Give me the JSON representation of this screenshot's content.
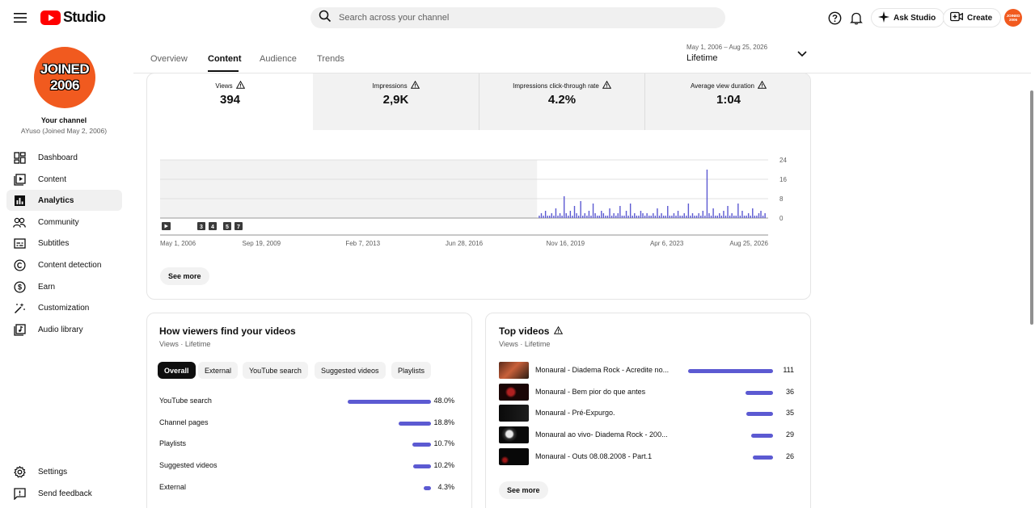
{
  "header": {
    "logo_text": "Studio",
    "search_placeholder": "Search across your channel",
    "ask_studio": "Ask Studio",
    "create": "Create",
    "avatar_text": "JOINED 2006"
  },
  "sidebar": {
    "avatar_line1": "JOINED",
    "avatar_line2": "2006",
    "your_channel": "Your channel",
    "channel_name": "AYuso (Joined May 2, 2006)",
    "items": [
      {
        "label": "Dashboard",
        "icon": "dashboard-icon"
      },
      {
        "label": "Content",
        "icon": "content-icon"
      },
      {
        "label": "Analytics",
        "icon": "analytics-icon"
      },
      {
        "label": "Community",
        "icon": "community-icon"
      },
      {
        "label": "Subtitles",
        "icon": "subtitles-icon"
      },
      {
        "label": "Content detection",
        "icon": "copyright-icon"
      },
      {
        "label": "Earn",
        "icon": "dollar-icon"
      },
      {
        "label": "Customization",
        "icon": "magic-wand-icon"
      },
      {
        "label": "Audio library",
        "icon": "audio-library-icon"
      }
    ],
    "bottom_items": [
      {
        "label": "Settings",
        "icon": "gear-icon"
      },
      {
        "label": "Send feedback",
        "icon": "feedback-icon"
      }
    ]
  },
  "tabs": [
    {
      "label": "Overview"
    },
    {
      "label": "Content"
    },
    {
      "label": "Audience"
    },
    {
      "label": "Trends"
    }
  ],
  "date_selector": {
    "range": "May 1, 2006 – Aug 25, 2026",
    "label": "Lifetime"
  },
  "metrics": [
    {
      "label": "Views",
      "value": "394"
    },
    {
      "label": "Impressions",
      "value": "2,9K"
    },
    {
      "label": "Impressions click-through rate",
      "value": "4.2%"
    },
    {
      "label": "Average view duration",
      "value": "1:04"
    }
  ],
  "chart_data": {
    "type": "bar",
    "series": [
      {
        "values": [
          1,
          2,
          1,
          3,
          1,
          1,
          2,
          1,
          4,
          1,
          2,
          1,
          9,
          2,
          1,
          3,
          1,
          5,
          2,
          1,
          7,
          1,
          2,
          1,
          3,
          1,
          6,
          2,
          1,
          1,
          3,
          2,
          1,
          1,
          4,
          1,
          2,
          1,
          2,
          5,
          1,
          1,
          3,
          1,
          6,
          1,
          2,
          1,
          1,
          3,
          2,
          1,
          2,
          1,
          1,
          2,
          1,
          4,
          1,
          2,
          1,
          1,
          5,
          1,
          1,
          2,
          1,
          3,
          1,
          1,
          2,
          1,
          6,
          1,
          2,
          1,
          1,
          2,
          1,
          3,
          1,
          20,
          2,
          1,
          4,
          1,
          1,
          2,
          1,
          3,
          1,
          5,
          1,
          2,
          1,
          1,
          6,
          1,
          3,
          1,
          1,
          2,
          1,
          4,
          1,
          1,
          2,
          3,
          1,
          2
        ]
      }
    ],
    "x_range": [
      "May 1, 2006",
      "Aug 25, 2026"
    ],
    "x_ticks": [
      "May 1, 2006",
      "Sep 19, 2009",
      "Feb 7, 2013",
      "Jun 28, 2016",
      "Nov 16, 2019",
      "Apr 6, 2023",
      "Aug 25, 2026"
    ],
    "y_ticks": [
      "24",
      "16",
      "8",
      "0"
    ],
    "ylim": [
      0,
      24
    ],
    "grid": true,
    "markers": [
      "3",
      "4",
      "5",
      "7"
    ]
  },
  "chart": {
    "see_more": "See more"
  },
  "traffic": {
    "title": "How viewers find your videos",
    "subtitle": "Views · Lifetime",
    "chips": [
      {
        "label": "Overall"
      },
      {
        "label": "External"
      },
      {
        "label": "YouTube search"
      },
      {
        "label": "Suggested videos"
      },
      {
        "label": "Playlists"
      }
    ],
    "rows": [
      {
        "label": "YouTube search",
        "pct_text": "48.0%",
        "pct": 48.0
      },
      {
        "label": "Channel pages",
        "pct_text": "18.8%",
        "pct": 18.8
      },
      {
        "label": "Playlists",
        "pct_text": "10.7%",
        "pct": 10.7
      },
      {
        "label": "Suggested videos",
        "pct_text": "10.2%",
        "pct": 10.2
      },
      {
        "label": "External",
        "pct_text": "4.3%",
        "pct": 4.3
      }
    ]
  },
  "top_videos": {
    "title": "Top videos",
    "subtitle": "Views · Lifetime",
    "see_more": "See more",
    "rows": [
      {
        "title": "Monaural - Diadema Rock - Acredite no...",
        "views": "111",
        "value": 111
      },
      {
        "title": "Monaural - Bem pior do que antes",
        "views": "36",
        "value": 36
      },
      {
        "title": "Monaural - Pré-Expurgo.",
        "views": "35",
        "value": 35
      },
      {
        "title": "Monaural ao vivo- Diadema Rock - 200...",
        "views": "29",
        "value": 29
      },
      {
        "title": "Monaural - Outs 08.08.2008 - Part.1",
        "views": "26",
        "value": 26
      }
    ]
  },
  "colors": {
    "accent_bar": "#5c5ad2",
    "avatar": "#f15a1f",
    "youtube_red": "#ff0000"
  }
}
